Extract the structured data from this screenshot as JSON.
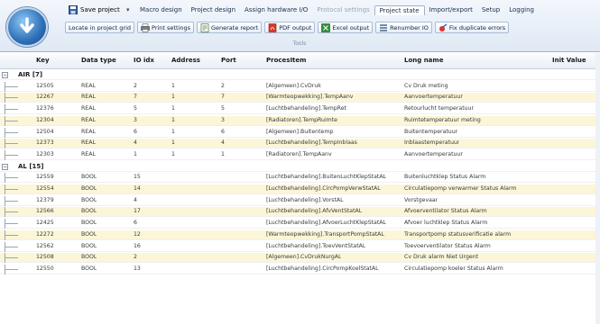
{
  "quick_access": {
    "save_label": "Save project"
  },
  "tabs": [
    {
      "label": "Macro design",
      "state": "normal"
    },
    {
      "label": "Project design",
      "state": "normal"
    },
    {
      "label": "Assign hardware I/O",
      "state": "normal"
    },
    {
      "label": "Protocol settings",
      "state": "disabled"
    },
    {
      "label": "Project state",
      "state": "active"
    },
    {
      "label": "Import/export",
      "state": "normal"
    },
    {
      "label": "Setup",
      "state": "normal"
    },
    {
      "label": "Logging",
      "state": "normal"
    }
  ],
  "toolbar": {
    "buttons": [
      {
        "label": "Locate in project grid",
        "icon": "none"
      },
      {
        "label": "Print settings",
        "icon": "printer-icon"
      },
      {
        "label": "Generate report",
        "icon": "report-icon"
      },
      {
        "label": "PDF output",
        "icon": "pdf-icon"
      },
      {
        "label": "Excel output",
        "icon": "excel-icon"
      },
      {
        "label": "Renumber IO",
        "icon": "renumber-icon"
      },
      {
        "label": "Fix duplicate errors",
        "icon": "fix-icon"
      }
    ],
    "group_label": "Tools"
  },
  "grid": {
    "columns": [
      "Key",
      "Data type",
      "IO idx",
      "Address",
      "Port",
      "ProcesItem",
      "Long name",
      "Init Value"
    ],
    "groups": [
      {
        "label": "AIR [7]",
        "rows": [
          [
            "12505",
            "REAL",
            "2",
            "1",
            "2",
            "[Algemeen].CvDruk",
            "Cv Druk meting"
          ],
          [
            "12267",
            "REAL",
            "7",
            "1",
            "7",
            "[Warmteopwekking].TempAanv",
            "Aanvoertemperatuur"
          ],
          [
            "12376",
            "REAL",
            "5",
            "1",
            "5",
            "[Luchtbehandeling].TempRet",
            "Retourlucht temperatuur"
          ],
          [
            "12304",
            "REAL",
            "3",
            "1",
            "3",
            "[Radiatoren].TempRuimte",
            "Ruimtetemperatuur meting"
          ],
          [
            "12504",
            "REAL",
            "6",
            "1",
            "6",
            "[Algemeen].Buitentemp",
            "Buitentemperatuur"
          ],
          [
            "12373",
            "REAL",
            "4",
            "1",
            "4",
            "[Luchtbehandeling].TempInblaas",
            "Inblaastemperatuur"
          ],
          [
            "12303",
            "REAL",
            "1",
            "1",
            "1",
            "[Radiatoren].TempAanv",
            "Aanvoertemperatuur"
          ]
        ]
      },
      {
        "label": "AL [15]",
        "rows": [
          [
            "12559",
            "BOOL",
            "15",
            "",
            "",
            "[Luchtbehandeling].BuitenLuchtKlepStatAL",
            "Buitenluchtklep Status Alarm"
          ],
          [
            "12554",
            "BOOL",
            "14",
            "",
            "",
            "[Luchtbehandeling].CircPompVerwStatAL",
            "Circulatiepomp verwarmer Status Alarm"
          ],
          [
            "12379",
            "BOOL",
            "4",
            "",
            "",
            "[Luchtbehandeling].VorstAL",
            "Vorstgevaar"
          ],
          [
            "12566",
            "BOOL",
            "17",
            "",
            "",
            "[Luchtbehandeling].AfvVentStatAL",
            "Afvoerventilator Status Alarm"
          ],
          [
            "12425",
            "BOOL",
            "6",
            "",
            "",
            "[Luchtbehandeling].AfvoerLuchtKlepStatAL",
            "Afvoer luchtklep Status Alarm"
          ],
          [
            "12272",
            "BOOL",
            "12",
            "",
            "",
            "[Warmteopwekking].TransportPompStatAL",
            "Transportpomp statusverificatie alarm"
          ],
          [
            "12562",
            "BOOL",
            "16",
            "",
            "",
            "[Luchtbehandeling].ToevVentStatAL",
            "Toevoerventilator Status Alarm"
          ],
          [
            "12508",
            "BOOL",
            "2",
            "",
            "",
            "[Algemeen].CvDrukNurgAL",
            "Cv Druk alarm Niet Urgent"
          ],
          [
            "12550",
            "BOOL",
            "13",
            "",
            "",
            "[Luchtbehandeling].CircPompKoelStatAL",
            "Circulatiepomp koeler Status Alarm"
          ]
        ]
      }
    ]
  },
  "colors": {
    "row_alt": "#fbf6d8",
    "ribbon": "#dfe8f4"
  }
}
